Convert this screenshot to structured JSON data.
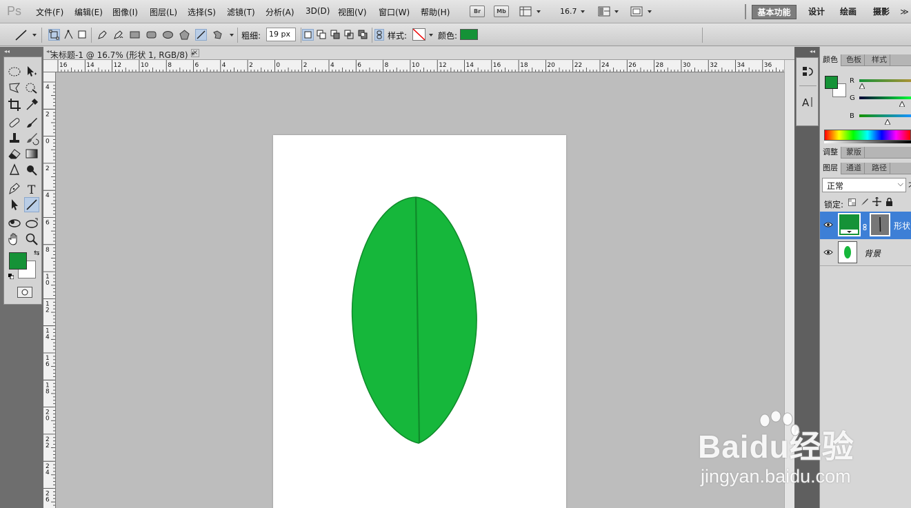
{
  "app": {
    "logo": "Ps"
  },
  "menu": [
    "文件(F)",
    "编辑(E)",
    "图像(I)",
    "图层(L)",
    "选择(S)",
    "滤镜(T)",
    "分析(A)",
    "3D(D)",
    "视图(V)",
    "窗口(W)",
    "帮助(H)"
  ],
  "menubar_buttons": {
    "bridge": "Br",
    "mini_bridge": "Mb",
    "zoom": "16.7"
  },
  "workspaces": [
    "基本功能",
    "设计",
    "绘画",
    "摄影"
  ],
  "more_glyph": "≫",
  "options": {
    "weight_label": "粗细:",
    "weight_value": "19 px",
    "style_label": "样式:",
    "color_label": "颜色:",
    "shape_color": "#159237"
  },
  "document": {
    "tab_title": "未标题-1 @ 16.7% (形状 1, RGB/8) *",
    "close_glyph": "×"
  },
  "ruler": {
    "h_labels": [
      "16",
      "14",
      "12",
      "10",
      "8",
      "6",
      "4",
      "2",
      "0",
      "2",
      "4",
      "6",
      "8",
      "10",
      "12",
      "14",
      "16",
      "18",
      "20",
      "22",
      "24",
      "26",
      "28",
      "30",
      "32",
      "34",
      "36"
    ],
    "v_labels": [
      "4",
      "2",
      "0",
      "2",
      "4",
      "6",
      "8",
      "10",
      "12",
      "14",
      "16",
      "18",
      "20",
      "22",
      "24",
      "26"
    ]
  },
  "colors": {
    "foreground": "#159237",
    "background": "#ffffff",
    "leaf": "#16b73b",
    "leaf_stroke": "#0f8a2a"
  },
  "color_panel": {
    "tabs": [
      "颜色",
      "色板",
      "样式"
    ],
    "channels": [
      "R",
      "G",
      "B"
    ],
    "levels": {
      "R": 0.05,
      "G": 0.83,
      "B": 0.55
    }
  },
  "adjust_panel": {
    "tabs": [
      "调整",
      "蒙版"
    ]
  },
  "layers_panel": {
    "tabs": [
      "图层",
      "通道",
      "路径"
    ],
    "blend_mode": "正常",
    "blend_cut": "不",
    "lock_label": "锁定:",
    "layers": [
      {
        "name": "形状 1",
        "selected": true
      },
      {
        "name": "背景",
        "selected": false
      }
    ]
  },
  "watermark": {
    "brand": "Baidu经验",
    "url": "jingyan.baidu.com"
  }
}
